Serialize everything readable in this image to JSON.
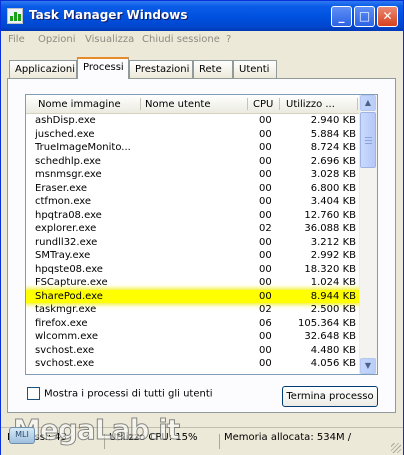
{
  "window": {
    "title": "Task Manager Windows"
  },
  "title_buttons": {
    "minimize": "_",
    "maximize": "□",
    "close": "✕"
  },
  "menu": [
    "File",
    "Opzioni",
    "Visualizza",
    "Chiudi sessione",
    "?"
  ],
  "tabs": [
    "Applicazioni",
    "Processi",
    "Prestazioni",
    "Rete",
    "Utenti"
  ],
  "active_tab": "Processi",
  "columns": [
    "Nome immagine",
    "Nome utente",
    "CPU",
    "Utilizzo ..."
  ],
  "processes": [
    {
      "name": "ashDisp.exe",
      "cpu": "00",
      "mem": "2.940 KB"
    },
    {
      "name": "jusched.exe",
      "cpu": "00",
      "mem": "5.884 KB"
    },
    {
      "name": "TrueImageMonito...",
      "cpu": "00",
      "mem": "8.724 KB"
    },
    {
      "name": "schedhlp.exe",
      "cpu": "00",
      "mem": "2.696 KB"
    },
    {
      "name": "msnmsgr.exe",
      "cpu": "00",
      "mem": "3.028 KB"
    },
    {
      "name": "Eraser.exe",
      "cpu": "00",
      "mem": "6.800 KB"
    },
    {
      "name": "ctfmon.exe",
      "cpu": "00",
      "mem": "3.404 KB"
    },
    {
      "name": "hpqtra08.exe",
      "cpu": "00",
      "mem": "12.760 KB"
    },
    {
      "name": "explorer.exe",
      "cpu": "02",
      "mem": "36.088 KB"
    },
    {
      "name": "rundll32.exe",
      "cpu": "00",
      "mem": "3.212 KB"
    },
    {
      "name": "SMTray.exe",
      "cpu": "00",
      "mem": "2.992 KB"
    },
    {
      "name": "hpqste08.exe",
      "cpu": "00",
      "mem": "18.320 KB"
    },
    {
      "name": "FSCapture.exe",
      "cpu": "00",
      "mem": "1.024 KB"
    },
    {
      "name": "SharePod.exe",
      "cpu": "00",
      "mem": "8.944 KB",
      "highlighted": true
    },
    {
      "name": "taskmgr.exe",
      "cpu": "02",
      "mem": "2.500 KB"
    },
    {
      "name": "firefox.exe",
      "cpu": "06",
      "mem": "105.364 KB"
    },
    {
      "name": "wlcomm.exe",
      "cpu": "00",
      "mem": "32.648 KB"
    },
    {
      "name": "svchost.exe",
      "cpu": "00",
      "mem": "4.480 KB"
    },
    {
      "name": "svchost.exe",
      "cpu": "00",
      "mem": "4.056 KB"
    }
  ],
  "scroll": {
    "up": "▲",
    "down": "▼"
  },
  "show_all_users": {
    "label": "Mostra i processi di tutti gli utenti",
    "checked": false
  },
  "end_process_button": "Termina processo",
  "status": {
    "processes": "Processi: 43",
    "cpu": "Utilizzo CPU: 15%",
    "memory": "Memoria allocata: 534M /"
  },
  "watermark": {
    "text": "MegaLab.it",
    "badge": "MLI"
  },
  "colors": {
    "titlebar": "#0052e0",
    "highlight": "#ffff00",
    "active_tab_accent": "#e68b2c"
  }
}
